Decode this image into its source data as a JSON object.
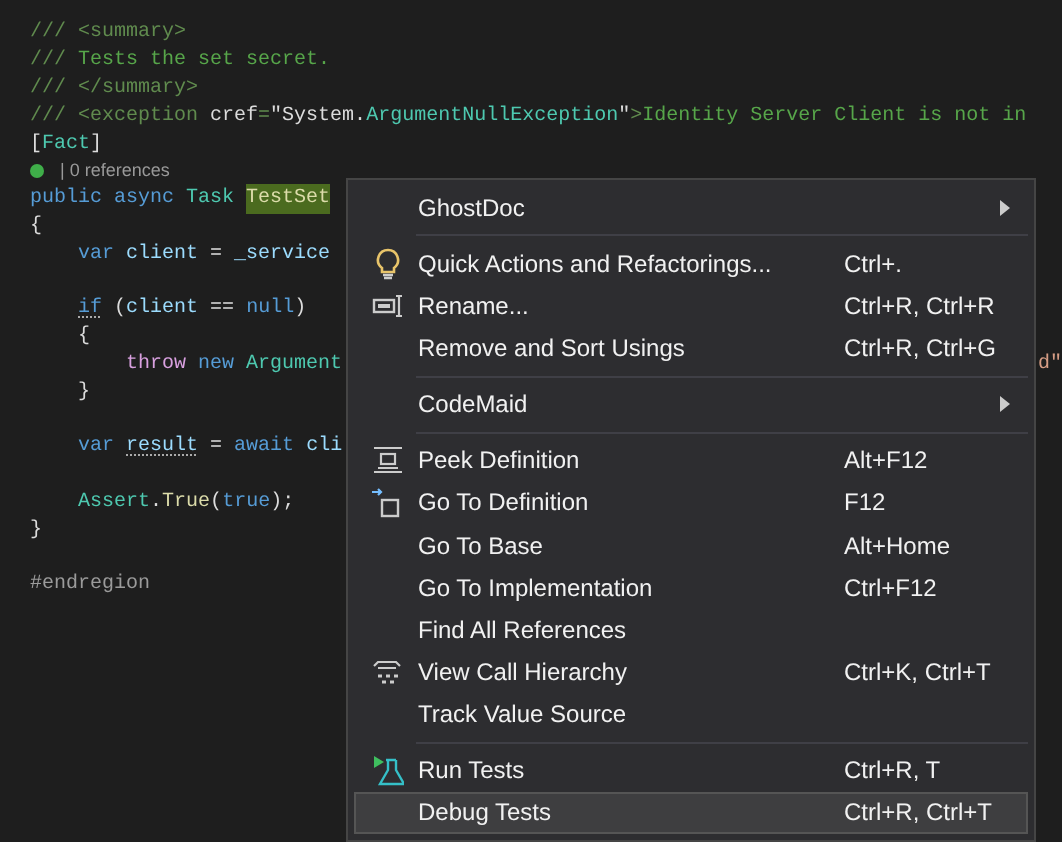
{
  "code_lines": [
    {
      "kind": "top",
      "words": [
        [
          {
            "kind": "doc",
            "text": "/// <summary>"
          }
        ]
      ]
    },
    {
      "kind": "top",
      "words": [
        [
          {
            "kind": "doc",
            "text": "///"
          }
        ],
        [
          {
            "kind": "comment",
            "text": "Tests the set secret."
          }
        ]
      ]
    },
    {
      "kind": "top",
      "words": [
        [
          {
            "kind": "doc",
            "text": "/// </summary>"
          }
        ]
      ]
    },
    {
      "kind": "top",
      "words": [
        [
          {
            "kind": "doc",
            "text": "/// <exception"
          }
        ],
        [
          {
            "kind": "plain",
            "text": "cref"
          },
          {
            "kind": "doc",
            "text": "="
          },
          {
            "kind": "plain",
            "text": "\"System."
          },
          {
            "kind": "type",
            "text": "ArgumentNullException"
          },
          {
            "kind": "plain",
            "text": "\""
          },
          {
            "kind": "doc",
            "text": ">"
          },
          {
            "kind": "comment",
            "text": "Identity Server Client is not in"
          }
        ]
      ]
    },
    {
      "kind": "top",
      "words": [
        [
          {
            "kind": "plain",
            "text": "["
          },
          {
            "kind": "type",
            "text": "Fact"
          },
          {
            "kind": "plain",
            "text": "]"
          }
        ]
      ]
    },
    {
      "kind": "codelens",
      "words": [
        [
          {
            "kind": "lens",
            "text": "| 0 references"
          }
        ]
      ]
    },
    {
      "kind": "top",
      "words": [
        [
          {
            "kind": "keyword",
            "text": "public"
          }
        ],
        [
          {
            "kind": "keyword",
            "text": "async"
          }
        ],
        [
          {
            "kind": "type",
            "text": "Task"
          }
        ],
        [
          {
            "kind": "highlight",
            "text": "TestSet"
          }
        ]
      ]
    },
    {
      "kind": "top",
      "words": [
        [
          {
            "kind": "plain",
            "text": "{"
          }
        ]
      ]
    },
    {
      "kind": "inner",
      "words": [
        [
          {
            "kind": "keyword",
            "text": "var"
          }
        ],
        [
          {
            "kind": "ident",
            "text": "client"
          }
        ],
        [
          {
            "kind": "plain",
            "text": "="
          }
        ],
        [
          {
            "kind": "ident",
            "text": "_service"
          }
        ]
      ]
    },
    {
      "kind": "blank"
    },
    {
      "kind": "inner",
      "words": [
        [
          {
            "kind": "hintkw",
            "text": "if"
          }
        ],
        [
          {
            "kind": "plain",
            "text": "("
          },
          {
            "kind": "ident",
            "text": "client"
          }
        ],
        [
          {
            "kind": "plain",
            "text": "=="
          }
        ],
        [
          {
            "kind": "keyword",
            "text": "null"
          },
          {
            "kind": "plain",
            "text": ")"
          }
        ]
      ]
    },
    {
      "kind": "inner",
      "words": [
        [
          {
            "kind": "plain",
            "text": "{"
          }
        ]
      ]
    },
    {
      "kind": "deep",
      "words": [
        [
          {
            "kind": "control",
            "text": "throw"
          }
        ],
        [
          {
            "kind": "keyword",
            "text": "new"
          }
        ],
        [
          {
            "kind": "type",
            "text": "Argument"
          }
        ]
      ],
      "tail": {
        "kind": "string",
        "text": "d\""
      }
    },
    {
      "kind": "inner",
      "words": [
        [
          {
            "kind": "plain",
            "text": "}"
          }
        ]
      ]
    },
    {
      "kind": "blank"
    },
    {
      "kind": "inner",
      "words": [
        [
          {
            "kind": "keyword",
            "text": "var"
          }
        ],
        [
          {
            "kind": "hint",
            "text": "result"
          }
        ],
        [
          {
            "kind": "plain",
            "text": "="
          }
        ],
        [
          {
            "kind": "keyword",
            "text": "await"
          }
        ],
        [
          {
            "kind": "ident",
            "text": "cli"
          }
        ]
      ]
    },
    {
      "kind": "blank"
    },
    {
      "kind": "inner",
      "words": [
        [
          {
            "kind": "type",
            "text": "Assert"
          },
          {
            "kind": "plain",
            "text": "."
          },
          {
            "kind": "method",
            "text": "True"
          },
          {
            "kind": "plain",
            "text": "("
          },
          {
            "kind": "keyword",
            "text": "true"
          },
          {
            "kind": "plain",
            "text": ");"
          }
        ]
      ]
    },
    {
      "kind": "top",
      "words": [
        [
          {
            "kind": "plain",
            "text": "}"
          }
        ]
      ]
    },
    {
      "kind": "blank"
    },
    {
      "kind": "top",
      "words": [
        [
          {
            "kind": "preproc",
            "text": "#endregion"
          }
        ]
      ]
    }
  ],
  "context_menu": [
    {
      "kind": "submenu",
      "label": "GhostDoc",
      "selected": false
    },
    {
      "kind": "separator"
    },
    {
      "kind": "lightbulb",
      "label": "Quick Actions and Refactorings...",
      "shortcut": "Ctrl+.",
      "selected": false
    },
    {
      "kind": "rename",
      "label": "Rename...",
      "shortcut": "Ctrl+R, Ctrl+R",
      "selected": false
    },
    {
      "kind": "plain",
      "label": "Remove and Sort Usings",
      "shortcut": "Ctrl+R, Ctrl+G",
      "selected": false
    },
    {
      "kind": "separator"
    },
    {
      "kind": "submenu",
      "label": "CodeMaid",
      "selected": false
    },
    {
      "kind": "separator"
    },
    {
      "kind": "peek",
      "label": "Peek Definition",
      "shortcut": "Alt+F12",
      "selected": false
    },
    {
      "kind": "goto",
      "label": "Go To Definition",
      "shortcut": "F12",
      "selected": false
    },
    {
      "kind": "plain",
      "label": "Go To Base",
      "shortcut": "Alt+Home",
      "selected": false
    },
    {
      "kind": "plain",
      "label": "Go To Implementation",
      "shortcut": "Ctrl+F12",
      "selected": false
    },
    {
      "kind": "plain",
      "label": "Find All References",
      "selected": false
    },
    {
      "kind": "hierarchy",
      "label": "View Call Hierarchy",
      "shortcut": "Ctrl+K, Ctrl+T",
      "selected": false
    },
    {
      "kind": "plain",
      "label": "Track Value Source",
      "selected": false
    },
    {
      "kind": "separator"
    },
    {
      "kind": "test",
      "label": "Run Tests",
      "shortcut": "Ctrl+R, T",
      "selected": false
    },
    {
      "kind": "plain",
      "label": "Debug Tests",
      "shortcut": "Ctrl+R, Ctrl+T",
      "selected": true
    }
  ]
}
